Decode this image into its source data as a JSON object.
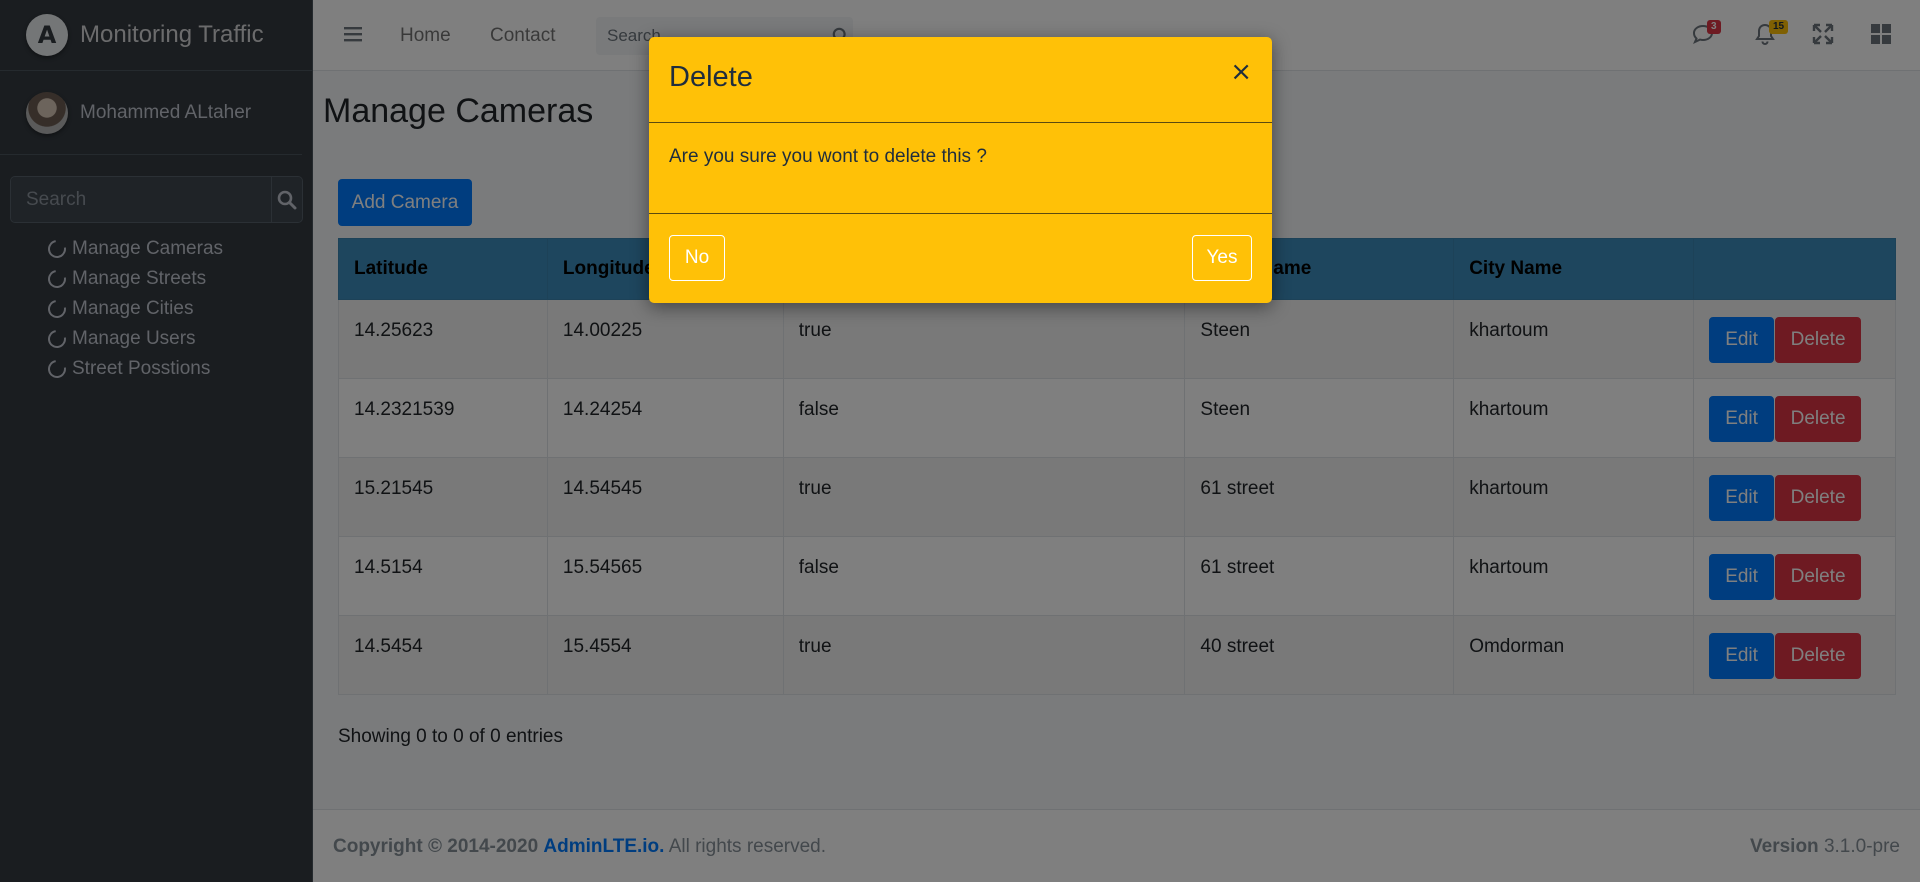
{
  "brand": {
    "logo_letter": "A",
    "title": "Monitoring Traffic"
  },
  "user": {
    "name": "Mohammed ALtaher"
  },
  "sidebar": {
    "search_placeholder": "Search",
    "items": [
      {
        "label": "Manage Cameras"
      },
      {
        "label": "Manage Streets"
      },
      {
        "label": "Manage Cities"
      },
      {
        "label": "Manage Users"
      },
      {
        "label": "Street Posstions"
      }
    ]
  },
  "topnav": {
    "links": [
      "Home",
      "Contact"
    ],
    "search_placeholder": "Search",
    "messages_badge": "3",
    "notifications_badge": "15"
  },
  "page": {
    "title": "Manage Cameras",
    "add_button": "Add Camera"
  },
  "table": {
    "headers": [
      "Latitude",
      "Longitude",
      "",
      "Street Name",
      "City Name",
      ""
    ],
    "rows": [
      {
        "lat": "14.25623",
        "lng": "14.00225",
        "status": "true",
        "street": "Steen",
        "city": "khartoum"
      },
      {
        "lat": "14.2321539",
        "lng": "14.24254",
        "status": "false",
        "street": "Steen",
        "city": "khartoum"
      },
      {
        "lat": "15.21545",
        "lng": "14.54545",
        "status": "true",
        "street": "61 street",
        "city": "khartoum"
      },
      {
        "lat": "14.5154",
        "lng": "15.54565",
        "status": "false",
        "street": "61 street",
        "city": "khartoum"
      },
      {
        "lat": "14.5454",
        "lng": "15.4554",
        "status": "true",
        "street": "40 street",
        "city": "Omdorman"
      }
    ],
    "edit_label": "Edit",
    "delete_label": "Delete",
    "entries_text": "Showing 0 to 0 of 0 entries"
  },
  "footer": {
    "copyright": "Copyright © 2014-2020",
    "link": "AdminLTE.io.",
    "rights": "All rights reserved.",
    "version_label": "Version",
    "version": "3.1.0-pre"
  },
  "modal": {
    "title": "Delete",
    "close": "×",
    "message": "Are you sure you wont to delete this ?",
    "no": "No",
    "yes": "Yes"
  },
  "colors": {
    "sidebar_bg": "#343a40",
    "header_bg": "#3c8dbc",
    "primary": "#007bff",
    "danger": "#dc3545",
    "modal_bg": "#ffc107"
  }
}
